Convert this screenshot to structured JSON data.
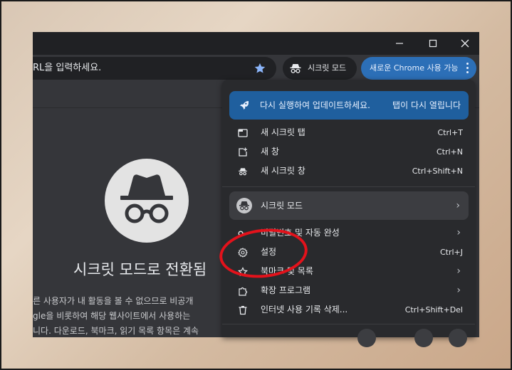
{
  "titlebar": {
    "minimize_icon": "minimize-icon",
    "maximize_icon": "maximize-icon",
    "close_icon": "close-icon"
  },
  "toolbar": {
    "omnibox_text": "RL을 입력하세요.",
    "incognito_chip_label": "시크릿 모드",
    "update_chip_label": "새로운 Chrome 사용 가능"
  },
  "page": {
    "heading": "시크릿 모드로 전환됨",
    "description_lines": [
      "른 사용자가 내 활동을 볼 수 없으므로 비공개",
      "gle을 비롯하여 해당 웹사이트에서 사용하는",
      "니다. 다운로드, 북마크, 읽기 목록 항목은 계속"
    ]
  },
  "menu": {
    "update_banner": {
      "text": "다시 실행하여 업데이트하세요.",
      "link": "탭이 다시 열립니다"
    },
    "items_top": [
      {
        "label": "새 시크릿 탭",
        "shortcut": "Ctrl+T",
        "icon": "new-tab-icon"
      },
      {
        "label": "새 창",
        "shortcut": "Ctrl+N",
        "icon": "new-window-icon"
      },
      {
        "label": "새 시크릿 창",
        "shortcut": "Ctrl+Shift+N",
        "icon": "incognito-icon"
      }
    ],
    "profile_label": "시크릿 모드",
    "items_bottom": [
      {
        "label": "비밀번호 및 자동 완성",
        "shortcut": "",
        "has_submenu": true,
        "icon": "key-icon"
      },
      {
        "label": "설정",
        "shortcut": "Ctrl+J",
        "has_submenu": false,
        "icon": "gear-icon"
      },
      {
        "label": "북마크 및 목록",
        "shortcut": "",
        "has_submenu": true,
        "icon": "star-icon"
      },
      {
        "label": "확장 프로그램",
        "shortcut": "",
        "has_submenu": true,
        "icon": "puzzle-icon"
      },
      {
        "label": "인터넷 사용 기록 삭제...",
        "shortcut": "Ctrl+Shift+Del",
        "has_submenu": false,
        "icon": "trash-icon"
      }
    ]
  },
  "colors": {
    "accent": "#2c6fb7",
    "banner": "#1f5f9e",
    "annotation": "#e3121b",
    "menu_bg": "#292a2d"
  }
}
